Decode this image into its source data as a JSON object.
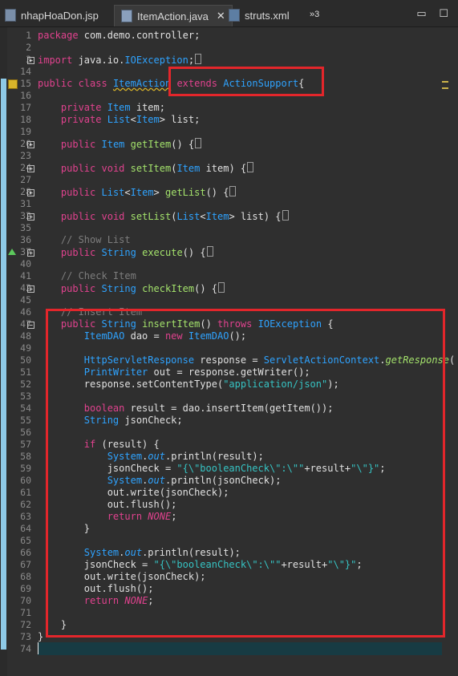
{
  "tabs": [
    {
      "label": "nhapHoaDon.jsp",
      "active": false
    },
    {
      "label": "ItemAction.java",
      "active": true
    },
    {
      "label": "struts.xml",
      "active": false
    }
  ],
  "overflow_count": "»3",
  "window_buttons": [
    "▭",
    "☐"
  ],
  "colors": {
    "keyword": "#e0428e",
    "type": "#2fa3ff",
    "method": "#a3e16b",
    "string": "#36c3c3",
    "comment": "#7d7d7d",
    "highlight": "#e3262b"
  },
  "code_lines": [
    {
      "n": "1",
      "t": "package com.demo.controller;"
    },
    {
      "n": "2",
      "t": ""
    },
    {
      "n": "3",
      "t": "import java.io.IOException;",
      "fold": "+"
    },
    {
      "n": "14",
      "t": ""
    },
    {
      "n": "15",
      "t": "public class ItemAction extends ActionSupport{"
    },
    {
      "n": "16",
      "t": ""
    },
    {
      "n": "17",
      "t": "    private Item item;"
    },
    {
      "n": "18",
      "t": "    private List<Item> list;"
    },
    {
      "n": "19",
      "t": ""
    },
    {
      "n": "20",
      "t": "    public Item getItem() {",
      "fold": "+"
    },
    {
      "n": "23",
      "t": ""
    },
    {
      "n": "24",
      "t": "    public void setItem(Item item) {",
      "fold": "+"
    },
    {
      "n": "27",
      "t": ""
    },
    {
      "n": "28",
      "t": "    public List<Item> getList() {",
      "fold": "+"
    },
    {
      "n": "31",
      "t": ""
    },
    {
      "n": "32",
      "t": "    public void setList(List<Item> list) {",
      "fold": "+"
    },
    {
      "n": "35",
      "t": ""
    },
    {
      "n": "36",
      "t": "    // Show List"
    },
    {
      "n": "37",
      "t": "    public String execute() {",
      "fold": "+"
    },
    {
      "n": "40",
      "t": ""
    },
    {
      "n": "41",
      "t": "    // Check Item"
    },
    {
      "n": "42",
      "t": "    public String checkItem() {",
      "fold": "+"
    },
    {
      "n": "45",
      "t": ""
    },
    {
      "n": "46",
      "t": "    // Insert Item"
    },
    {
      "n": "47",
      "t": "    public String insertItem() throws IOException {",
      "fold": "-"
    },
    {
      "n": "48",
      "t": "        ItemDAO dao = new ItemDAO();"
    },
    {
      "n": "49",
      "t": ""
    },
    {
      "n": "50",
      "t": "        HttpServletResponse response = ServletActionContext.getResponse("
    },
    {
      "n": "51",
      "t": "        PrintWriter out = response.getWriter();"
    },
    {
      "n": "52",
      "t": "        response.setContentType(\"application/json\");"
    },
    {
      "n": "53",
      "t": ""
    },
    {
      "n": "54",
      "t": "        boolean result = dao.insertItem(getItem());"
    },
    {
      "n": "55",
      "t": "        String jsonCheck;"
    },
    {
      "n": "56",
      "t": ""
    },
    {
      "n": "57",
      "t": "        if (result) {"
    },
    {
      "n": "58",
      "t": "            System.out.println(result);"
    },
    {
      "n": "59",
      "t": "            jsonCheck = \"{\\\"booleanCheck\\\":\\\"\"+result+\"\\\"}\";"
    },
    {
      "n": "60",
      "t": "            System.out.println(jsonCheck);"
    },
    {
      "n": "61",
      "t": "            out.write(jsonCheck);"
    },
    {
      "n": "62",
      "t": "            out.flush();"
    },
    {
      "n": "63",
      "t": "            return NONE;"
    },
    {
      "n": "64",
      "t": "        }"
    },
    {
      "n": "65",
      "t": ""
    },
    {
      "n": "66",
      "t": "        System.out.println(result);"
    },
    {
      "n": "67",
      "t": "        jsonCheck = \"{\\\"booleanCheck\\\":\\\"\"+result+\"\\\"}\";"
    },
    {
      "n": "68",
      "t": "        out.write(jsonCheck);"
    },
    {
      "n": "69",
      "t": "        out.flush();"
    },
    {
      "n": "70",
      "t": "        return NONE;"
    },
    {
      "n": "71",
      "t": ""
    },
    {
      "n": "72",
      "t": "    }"
    },
    {
      "n": "73",
      "t": "}"
    },
    {
      "n": "74",
      "t": ""
    }
  ]
}
